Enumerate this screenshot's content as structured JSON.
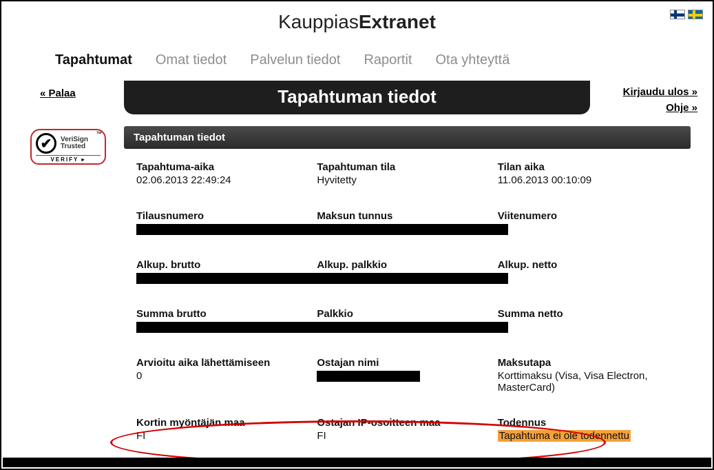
{
  "brand": {
    "left": "Kauppias",
    "right": "Extranet"
  },
  "nav": {
    "items": [
      "Tapahtumat",
      "Omat tiedot",
      "Palvelun tiedot",
      "Raportit",
      "Ota yhteyttä"
    ],
    "active_index": 0
  },
  "back_label": "« Palaa",
  "page_title": "Tapahtuman tiedot",
  "logout_label": "Kirjaudu ulos »",
  "help_label": "Ohje »",
  "badge": {
    "name": "VeriSign Trusted",
    "verify": "VERIFY ▸",
    "mark": "™"
  },
  "section_header": "Tapahtuman tiedot",
  "rows": [
    [
      {
        "label": "Tapahtuma-aika",
        "value": "02.06.2013 22:49:24"
      },
      {
        "label": "Tapahtuman tila",
        "value": "Hyvitetty"
      },
      {
        "label": "Tilan aika",
        "value": "11.06.2013 00:10:09"
      }
    ],
    [
      {
        "label": "Tilausnumero",
        "value": ""
      },
      {
        "label": "Maksun tunnus",
        "value": ""
      },
      {
        "label": "Viitenumero",
        "value": ""
      }
    ],
    [
      {
        "label": "Alkup. brutto",
        "value": ""
      },
      {
        "label": "Alkup. palkkio",
        "value": ""
      },
      {
        "label": "Alkup. netto",
        "value": ""
      }
    ],
    [
      {
        "label": "Summa brutto",
        "value": ""
      },
      {
        "label": "Palkkio",
        "value": ""
      },
      {
        "label": "Summa netto",
        "value": ""
      }
    ],
    [
      {
        "label": "Arvioitu aika lähettämiseen",
        "value": "0"
      },
      {
        "label": "Ostajan nimi",
        "value": ""
      },
      {
        "label": "Maksutapa",
        "value": "Korttimaksu (Visa, Visa Electron, MasterCard)"
      }
    ],
    [
      {
        "label": "Kortin myöntäjän maa",
        "value": "FI"
      },
      {
        "label": "Ostajan IP-osoitteen maa",
        "value": "FI"
      },
      {
        "label": "Todennus",
        "value": "Tapahtuma ei ole todennettu",
        "highlight": true
      }
    ]
  ]
}
